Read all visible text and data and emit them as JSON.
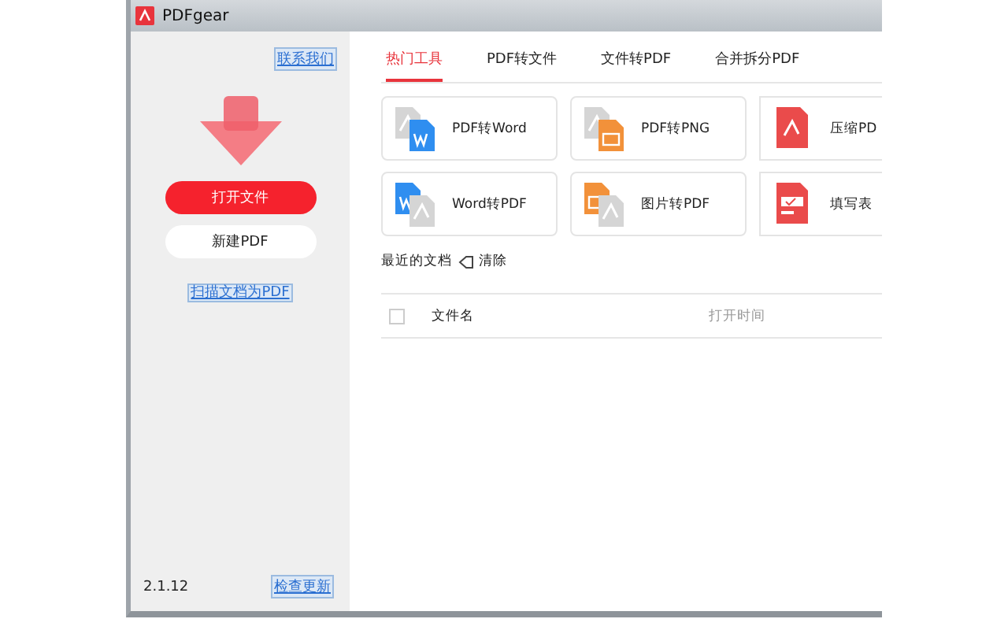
{
  "window": {
    "title": "PDFgear"
  },
  "sidebar": {
    "contact_link": "联系我们",
    "open_button": "打开文件",
    "new_button": "新建PDF",
    "scan_link": "扫描文档为PDF",
    "version": "2.1.12",
    "update_link": "检查更新"
  },
  "tabs": [
    {
      "label": "热门工具",
      "selected": true
    },
    {
      "label": "PDF转文件",
      "selected": false
    },
    {
      "label": "文件转PDF",
      "selected": false
    },
    {
      "label": "合并拆分PDF",
      "selected": false
    }
  ],
  "tools": [
    {
      "label": "PDF转Word",
      "kind": "pdf-word"
    },
    {
      "label": "PDF转PNG",
      "kind": "pdf-image"
    },
    {
      "label": "压缩PD",
      "kind": "compress"
    },
    {
      "label": "Word转PDF",
      "kind": "word-pdf"
    },
    {
      "label": "图片转PDF",
      "kind": "image-pdf"
    },
    {
      "label": "填写表",
      "kind": "form"
    }
  ],
  "recent": {
    "title": "最近的文档",
    "clear_button": "清除",
    "select_all_checked": false,
    "columns": [
      "文件名",
      "打开时间"
    ]
  }
}
